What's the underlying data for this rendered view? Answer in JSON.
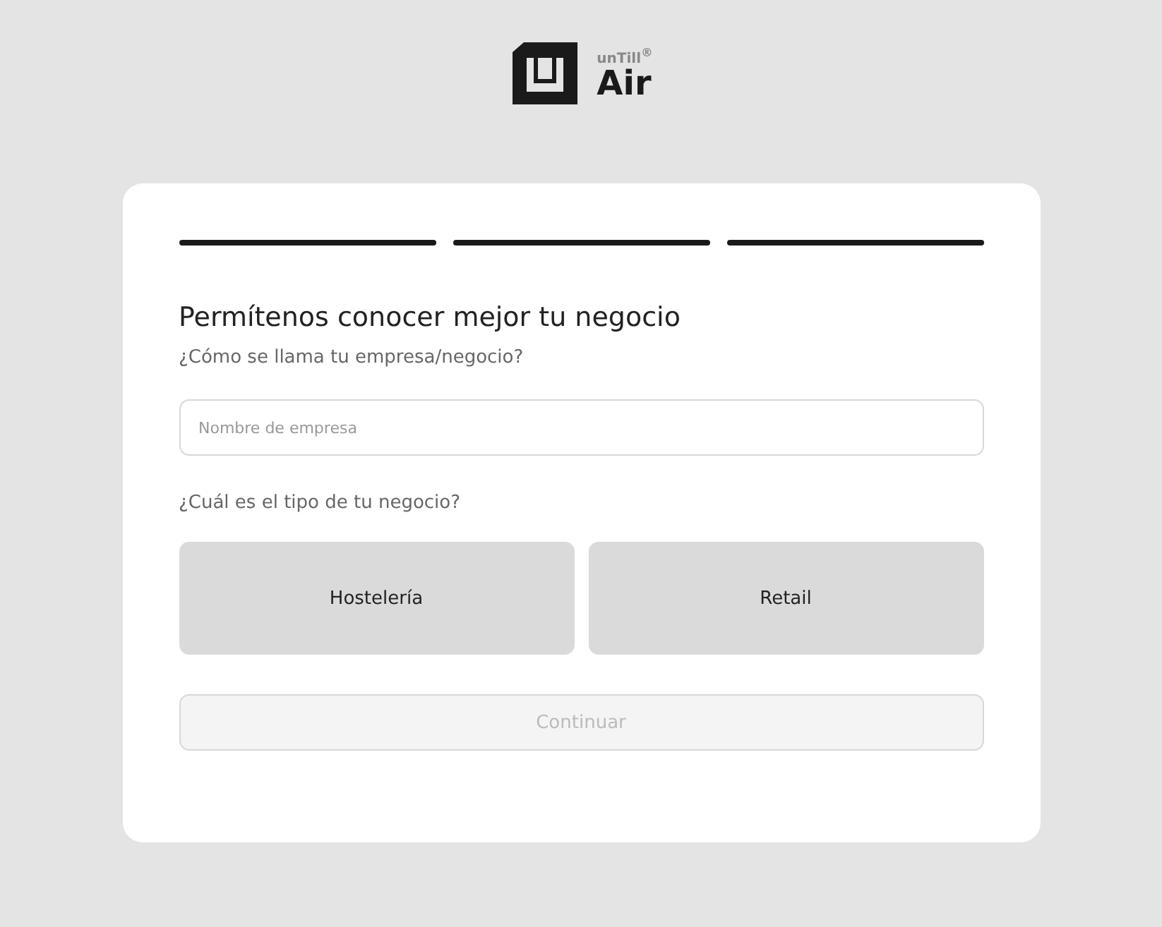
{
  "logo": {
    "brand": "unTill$^{®}$",
    "product": "Air"
  },
  "steps": [
    {
      "done": true
    },
    {
      "done": true
    },
    {
      "done": true
    }
  ],
  "title": "Permítenos conocer mejor tu negocio",
  "name_question": "¿Cómo se llama tu empresa/negocio?",
  "name_field": {
    "placeholder": "Nombre de empresa"
  },
  "type_question": "¿Cuál es el tipo de tu negocio?",
  "business_types": [
    {
      "label": "Hostelería",
      "selected": false
    },
    {
      "label": "Retail",
      "selected": false
    }
  ],
  "continue_button": {
    "label": "Continuar",
    "disabled": true
  }
}
